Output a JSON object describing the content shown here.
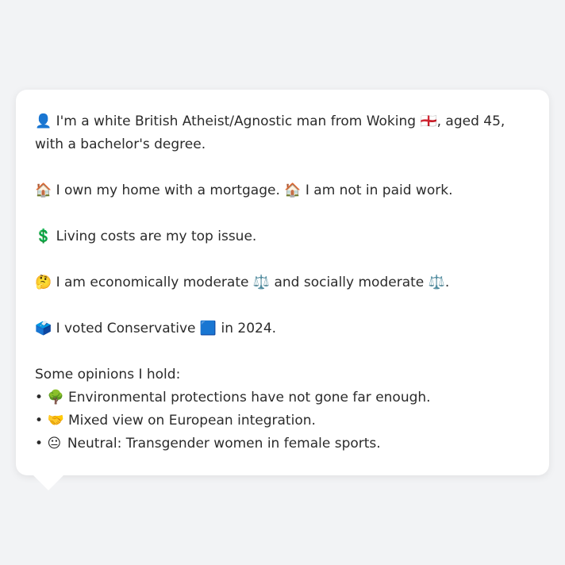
{
  "profile": {
    "identity": {
      "icon": "person-silhouette-icon",
      "emoji": "👤",
      "text_before_flag": "I'm a white British Atheist/Agnostic man from Woking",
      "flag_emoji": "🏴󠁧󠁢󠁥󠁮󠁧󠁿",
      "flag_icon": "england-flag-icon",
      "text_after_flag": ", aged 45, with a bachelor's degree."
    },
    "housing": {
      "emoji1": "🏠",
      "icon1": "house-icon",
      "text1": "I own my home with a mortgage.",
      "emoji2": "🏠",
      "icon2": "house-icon",
      "text2": "I am not in paid work."
    },
    "issue": {
      "emoji": "💲",
      "icon": "dollar-sign-icon",
      "text": "Living costs are my top issue."
    },
    "ideology": {
      "emoji": "🤔",
      "icon": "thinking-face-icon",
      "text1": "I am economically moderate",
      "scale_emoji1": "⚖️",
      "text2": "and socially moderate",
      "scale_emoji2": "⚖️",
      "text3": "."
    },
    "vote": {
      "emoji": "🗳️",
      "icon": "ballot-box-icon",
      "text1": "I voted Conservative",
      "party_emoji": "🟦",
      "party_icon": "blue-square-icon",
      "text2": "in 2024."
    },
    "opinions": {
      "heading": "Some opinions I hold:",
      "items": [
        {
          "bullet": "•",
          "emoji": "🌳",
          "icon": "tree-icon",
          "text": "Environmental protections have not gone far enough."
        },
        {
          "bullet": "•",
          "emoji": "🤝",
          "icon": "handshake-icon",
          "text": "Mixed view on European integration."
        },
        {
          "bullet": "•",
          "emoji": "😐",
          "icon": "neutral-face-icon",
          "text": "Neutral: Transgender women in female sports."
        }
      ]
    }
  },
  "colors": {
    "background": "#f2f3f5",
    "bubble": "#ffffff",
    "text": "#2b2b2b"
  }
}
